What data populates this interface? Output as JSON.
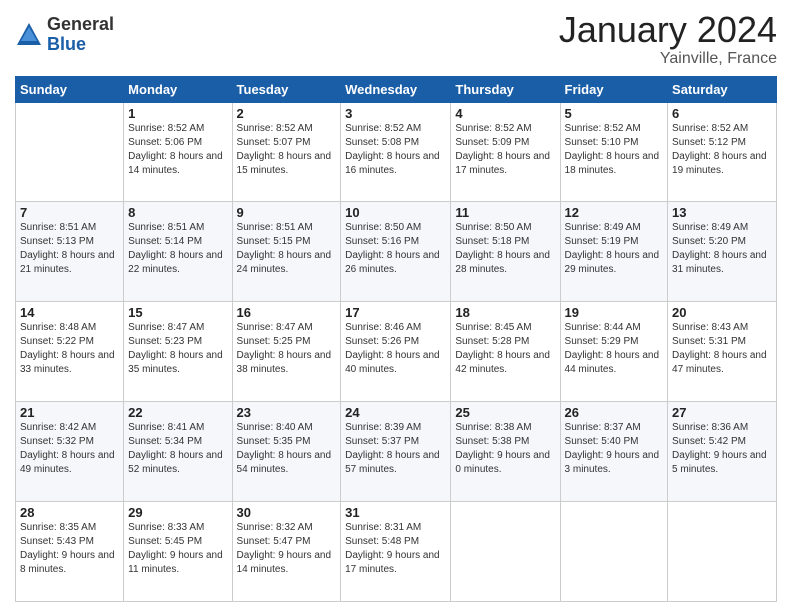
{
  "logo": {
    "general": "General",
    "blue": "Blue"
  },
  "header": {
    "month": "January 2024",
    "location": "Yainville, France"
  },
  "days_of_week": [
    "Sunday",
    "Monday",
    "Tuesday",
    "Wednesday",
    "Thursday",
    "Friday",
    "Saturday"
  ],
  "weeks": [
    [
      {
        "day": "",
        "sunrise": "",
        "sunset": "",
        "daylight": ""
      },
      {
        "day": "1",
        "sunrise": "Sunrise: 8:52 AM",
        "sunset": "Sunset: 5:06 PM",
        "daylight": "Daylight: 8 hours and 14 minutes."
      },
      {
        "day": "2",
        "sunrise": "Sunrise: 8:52 AM",
        "sunset": "Sunset: 5:07 PM",
        "daylight": "Daylight: 8 hours and 15 minutes."
      },
      {
        "day": "3",
        "sunrise": "Sunrise: 8:52 AM",
        "sunset": "Sunset: 5:08 PM",
        "daylight": "Daylight: 8 hours and 16 minutes."
      },
      {
        "day": "4",
        "sunrise": "Sunrise: 8:52 AM",
        "sunset": "Sunset: 5:09 PM",
        "daylight": "Daylight: 8 hours and 17 minutes."
      },
      {
        "day": "5",
        "sunrise": "Sunrise: 8:52 AM",
        "sunset": "Sunset: 5:10 PM",
        "daylight": "Daylight: 8 hours and 18 minutes."
      },
      {
        "day": "6",
        "sunrise": "Sunrise: 8:52 AM",
        "sunset": "Sunset: 5:12 PM",
        "daylight": "Daylight: 8 hours and 19 minutes."
      }
    ],
    [
      {
        "day": "7",
        "sunrise": "Sunrise: 8:51 AM",
        "sunset": "Sunset: 5:13 PM",
        "daylight": "Daylight: 8 hours and 21 minutes."
      },
      {
        "day": "8",
        "sunrise": "Sunrise: 8:51 AM",
        "sunset": "Sunset: 5:14 PM",
        "daylight": "Daylight: 8 hours and 22 minutes."
      },
      {
        "day": "9",
        "sunrise": "Sunrise: 8:51 AM",
        "sunset": "Sunset: 5:15 PM",
        "daylight": "Daylight: 8 hours and 24 minutes."
      },
      {
        "day": "10",
        "sunrise": "Sunrise: 8:50 AM",
        "sunset": "Sunset: 5:16 PM",
        "daylight": "Daylight: 8 hours and 26 minutes."
      },
      {
        "day": "11",
        "sunrise": "Sunrise: 8:50 AM",
        "sunset": "Sunset: 5:18 PM",
        "daylight": "Daylight: 8 hours and 28 minutes."
      },
      {
        "day": "12",
        "sunrise": "Sunrise: 8:49 AM",
        "sunset": "Sunset: 5:19 PM",
        "daylight": "Daylight: 8 hours and 29 minutes."
      },
      {
        "day": "13",
        "sunrise": "Sunrise: 8:49 AM",
        "sunset": "Sunset: 5:20 PM",
        "daylight": "Daylight: 8 hours and 31 minutes."
      }
    ],
    [
      {
        "day": "14",
        "sunrise": "Sunrise: 8:48 AM",
        "sunset": "Sunset: 5:22 PM",
        "daylight": "Daylight: 8 hours and 33 minutes."
      },
      {
        "day": "15",
        "sunrise": "Sunrise: 8:47 AM",
        "sunset": "Sunset: 5:23 PM",
        "daylight": "Daylight: 8 hours and 35 minutes."
      },
      {
        "day": "16",
        "sunrise": "Sunrise: 8:47 AM",
        "sunset": "Sunset: 5:25 PM",
        "daylight": "Daylight: 8 hours and 38 minutes."
      },
      {
        "day": "17",
        "sunrise": "Sunrise: 8:46 AM",
        "sunset": "Sunset: 5:26 PM",
        "daylight": "Daylight: 8 hours and 40 minutes."
      },
      {
        "day": "18",
        "sunrise": "Sunrise: 8:45 AM",
        "sunset": "Sunset: 5:28 PM",
        "daylight": "Daylight: 8 hours and 42 minutes."
      },
      {
        "day": "19",
        "sunrise": "Sunrise: 8:44 AM",
        "sunset": "Sunset: 5:29 PM",
        "daylight": "Daylight: 8 hours and 44 minutes."
      },
      {
        "day": "20",
        "sunrise": "Sunrise: 8:43 AM",
        "sunset": "Sunset: 5:31 PM",
        "daylight": "Daylight: 8 hours and 47 minutes."
      }
    ],
    [
      {
        "day": "21",
        "sunrise": "Sunrise: 8:42 AM",
        "sunset": "Sunset: 5:32 PM",
        "daylight": "Daylight: 8 hours and 49 minutes."
      },
      {
        "day": "22",
        "sunrise": "Sunrise: 8:41 AM",
        "sunset": "Sunset: 5:34 PM",
        "daylight": "Daylight: 8 hours and 52 minutes."
      },
      {
        "day": "23",
        "sunrise": "Sunrise: 8:40 AM",
        "sunset": "Sunset: 5:35 PM",
        "daylight": "Daylight: 8 hours and 54 minutes."
      },
      {
        "day": "24",
        "sunrise": "Sunrise: 8:39 AM",
        "sunset": "Sunset: 5:37 PM",
        "daylight": "Daylight: 8 hours and 57 minutes."
      },
      {
        "day": "25",
        "sunrise": "Sunrise: 8:38 AM",
        "sunset": "Sunset: 5:38 PM",
        "daylight": "Daylight: 9 hours and 0 minutes."
      },
      {
        "day": "26",
        "sunrise": "Sunrise: 8:37 AM",
        "sunset": "Sunset: 5:40 PM",
        "daylight": "Daylight: 9 hours and 3 minutes."
      },
      {
        "day": "27",
        "sunrise": "Sunrise: 8:36 AM",
        "sunset": "Sunset: 5:42 PM",
        "daylight": "Daylight: 9 hours and 5 minutes."
      }
    ],
    [
      {
        "day": "28",
        "sunrise": "Sunrise: 8:35 AM",
        "sunset": "Sunset: 5:43 PM",
        "daylight": "Daylight: 9 hours and 8 minutes."
      },
      {
        "day": "29",
        "sunrise": "Sunrise: 8:33 AM",
        "sunset": "Sunset: 5:45 PM",
        "daylight": "Daylight: 9 hours and 11 minutes."
      },
      {
        "day": "30",
        "sunrise": "Sunrise: 8:32 AM",
        "sunset": "Sunset: 5:47 PM",
        "daylight": "Daylight: 9 hours and 14 minutes."
      },
      {
        "day": "31",
        "sunrise": "Sunrise: 8:31 AM",
        "sunset": "Sunset: 5:48 PM",
        "daylight": "Daylight: 9 hours and 17 minutes."
      },
      {
        "day": "",
        "sunrise": "",
        "sunset": "",
        "daylight": ""
      },
      {
        "day": "",
        "sunrise": "",
        "sunset": "",
        "daylight": ""
      },
      {
        "day": "",
        "sunrise": "",
        "sunset": "",
        "daylight": ""
      }
    ]
  ]
}
